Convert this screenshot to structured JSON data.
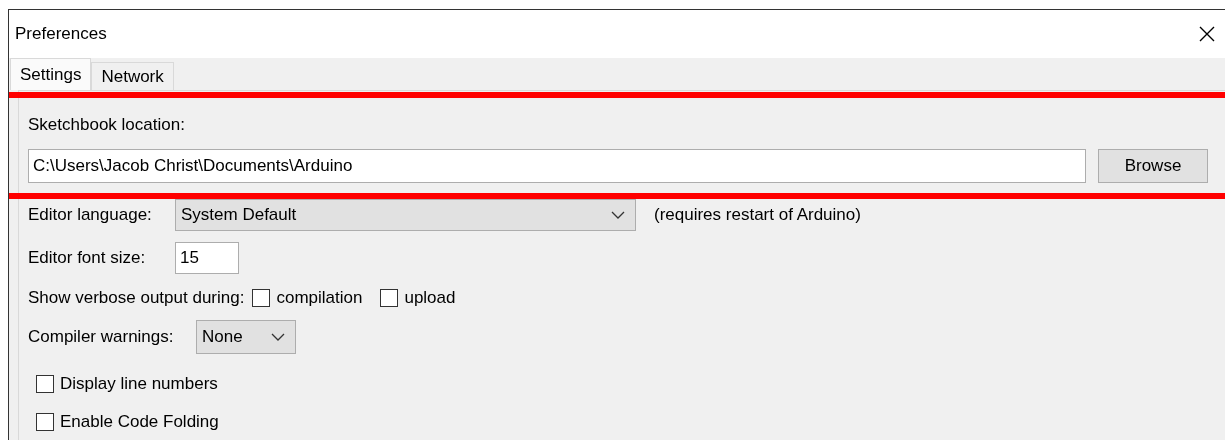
{
  "window": {
    "title": "Preferences"
  },
  "tabs": [
    {
      "label": "Settings",
      "selected": true
    },
    {
      "label": "Network",
      "selected": false
    }
  ],
  "sketchbook": {
    "label": "Sketchbook location:",
    "value": "C:\\Users\\Jacob Christ\\Documents\\Arduino",
    "button": "Browse"
  },
  "editor_language": {
    "label": "Editor language:",
    "value": "System Default",
    "note": "(requires restart of Arduino)"
  },
  "font_size": {
    "label": "Editor font size:",
    "value": "15"
  },
  "verbose": {
    "label": "Show verbose output during:",
    "options": [
      {
        "label": "compilation",
        "checked": false
      },
      {
        "label": "upload",
        "checked": false
      }
    ]
  },
  "compiler_warnings": {
    "label": "Compiler warnings:",
    "value": "None"
  },
  "options": [
    {
      "label": "Display line numbers",
      "checked": false
    },
    {
      "label": "Enable Code Folding",
      "checked": false
    }
  ]
}
